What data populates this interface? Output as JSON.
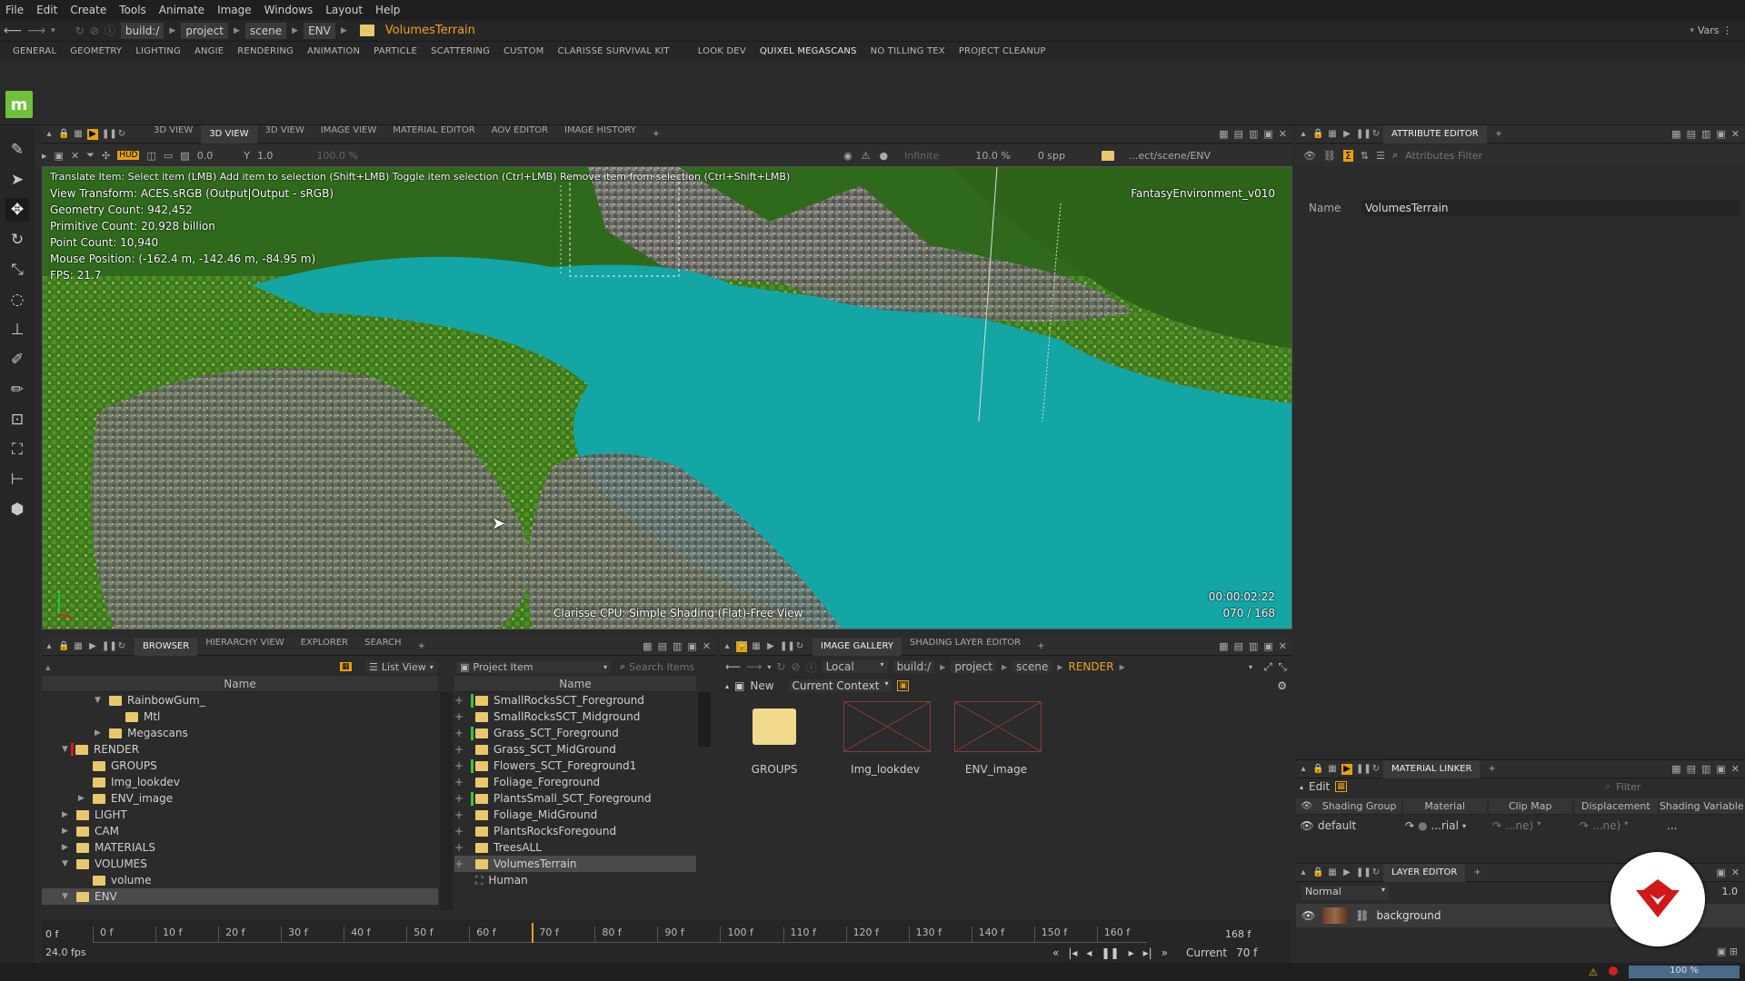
{
  "menu": [
    "File",
    "Edit",
    "Create",
    "Tools",
    "Animate",
    "Image",
    "Windows",
    "Layout",
    "Help"
  ],
  "path": {
    "segments": [
      "build:/",
      "project",
      "scene",
      "ENV"
    ],
    "current": "VolumesTerrain",
    "vars": "Vars"
  },
  "shelf_tabs": [
    "GENERAL",
    "GEOMETRY",
    "LIGHTING",
    "ANGIE",
    "RENDERING",
    "ANIMATION",
    "PARTICLE",
    "SCATTERING",
    "CUSTOM",
    "CLARISSE SURVIVAL KIT",
    "LOOK DEV",
    "QUIXEL MEGASCANS",
    "NO TILLING TEX",
    "PROJECT CLEANUP"
  ],
  "shelf_active": "QUIXEL MEGASCANS",
  "logo_letter": "m",
  "viewport_tabs": [
    "3D VIEW",
    "3D VIEW",
    "3D VIEW",
    "IMAGE VIEW",
    "MATERIAL EDITOR",
    "AOV EDITOR",
    "IMAGE HISTORY"
  ],
  "viewport_active_tab": 1,
  "vptool": {
    "exposure": "0.0",
    "gamma": "1.0",
    "pct": "100.0 %",
    "infinite": "Infinite",
    "zoom": "10.0 %",
    "spp": "0 spp",
    "path": "...ect/scene/ENV"
  },
  "overlay": {
    "help": "Translate Item: Select item (LMB)  Add item to selection (Shift+LMB)  Toggle item selection (Ctrl+LMB)  Remove item from selection (Ctrl+Shift+LMB)",
    "lines": [
      "View Transform: ACES.sRGB (Output|Output - sRGB)",
      "Geometry Count: 942,452",
      "Primitive Count: 20.928 billion",
      "Point Count: 10,940",
      "Mouse Position: (-162.4 m, -142.46 m, -84.95 m)",
      "FPS: 21.7"
    ],
    "scene_name": "FantasyEnvironment_v010",
    "timecode": "00:00:02:22",
    "frame": "070 / 168",
    "mode": "Clarisse CPU: Simple Shading (Flat)-Free View"
  },
  "attr_editor": {
    "tab": "ATTRIBUTE EDITOR",
    "filter_placeholder": "Attributes Filter",
    "name_label": "Name",
    "name_value": "VolumesTerrain"
  },
  "browser": {
    "tabs": [
      "BROWSER",
      "HIERARCHY VIEW",
      "EXPLORER",
      "SEARCH"
    ],
    "view_mode": "List View",
    "project_item": "Project Item",
    "search_placeholder": "Search Items",
    "col_name": "Name",
    "tree": [
      {
        "label": "RainbowGum_",
        "indent": 3,
        "arrow": "▼"
      },
      {
        "label": "Mtl",
        "indent": 4,
        "arrow": ""
      },
      {
        "label": "Megascans",
        "indent": 3,
        "arrow": "▶"
      },
      {
        "label": "RENDER",
        "indent": 1,
        "arrow": "▼"
      },
      {
        "label": "GROUPS",
        "indent": 2,
        "arrow": ""
      },
      {
        "label": "Img_lookdev",
        "indent": 2,
        "arrow": ""
      },
      {
        "label": "ENV_image",
        "indent": 2,
        "arrow": "▶"
      },
      {
        "label": "LIGHT",
        "indent": 1,
        "arrow": "▶"
      },
      {
        "label": "CAM",
        "indent": 1,
        "arrow": "▶"
      },
      {
        "label": "MATERIALS",
        "indent": 1,
        "arrow": "▶"
      },
      {
        "label": "VOLUMES",
        "indent": 1,
        "arrow": "▼"
      },
      {
        "label": "volume",
        "indent": 2,
        "arrow": ""
      },
      {
        "label": "ENV",
        "indent": 1,
        "arrow": "▼"
      }
    ],
    "items": [
      {
        "label": "SmallRocksSCT_Foreground",
        "bar": true
      },
      {
        "label": "SmallRocksSCT_Midground",
        "bar": false
      },
      {
        "label": "Grass_SCT_Foreground",
        "bar": true
      },
      {
        "label": "Grass_SCT_MidGround",
        "bar": false
      },
      {
        "label": "Flowers_SCT_Foreground1",
        "bar": true
      },
      {
        "label": "Foliage_Foreground",
        "bar": false
      },
      {
        "label": "PlantsSmall_SCT_Foreground",
        "bar": true
      },
      {
        "label": "Foliage_MidGround",
        "bar": false
      },
      {
        "label": "PlantsRocksForegound",
        "bar": false
      },
      {
        "label": "TreesALL",
        "bar": false
      },
      {
        "label": "VolumesTerrain",
        "bar": false
      },
      {
        "label": "Human",
        "bar": false
      }
    ]
  },
  "gallery": {
    "tabs": [
      "IMAGE GALLERY",
      "SHADING LAYER EDITOR"
    ],
    "local": "Local",
    "path": [
      "build:/",
      "project",
      "scene"
    ],
    "current": "RENDER",
    "new_label": "New",
    "context": "Current Context",
    "items": [
      "GROUPS",
      "Img_lookdev",
      "ENV_image"
    ]
  },
  "material_linker": {
    "tab": "MATERIAL LINKER",
    "edit": "Edit",
    "filter_placeholder": "Filter",
    "cols": [
      "Shading Group",
      "Material",
      "Clip Map",
      "Displacement",
      "Shading Variable"
    ],
    "row": {
      "group": "default",
      "material": "...rial",
      "clip": "...ne)",
      "disp": "...ne)",
      "var": "..."
    }
  },
  "layer_editor": {
    "tab": "LAYER EDITOR",
    "blend": "Normal",
    "opacity": "1.0",
    "layer": "background"
  },
  "timeline": {
    "start_label": "0 f",
    "fps": "24.0 fps",
    "end": "168 f",
    "current_label": "Current",
    "current": "70 f",
    "ticks": [
      "0 f",
      "10 f",
      "20 f",
      "30 f",
      "40 f",
      "50 f",
      "60 f",
      "70 f",
      "80 f",
      "90 f",
      "100 f",
      "110 f",
      "120 f",
      "130 f",
      "140 f",
      "150 f",
      "160 f"
    ],
    "playhead_frame": 70,
    "frame_range": [
      0,
      168
    ]
  },
  "status": {
    "zoom": "100 %"
  },
  "colors": {
    "accent": "#f0a020",
    "logo": "#6fc13a",
    "water": "#14a5a5",
    "grass": "#3f7f1d",
    "badge": "#d01818"
  }
}
